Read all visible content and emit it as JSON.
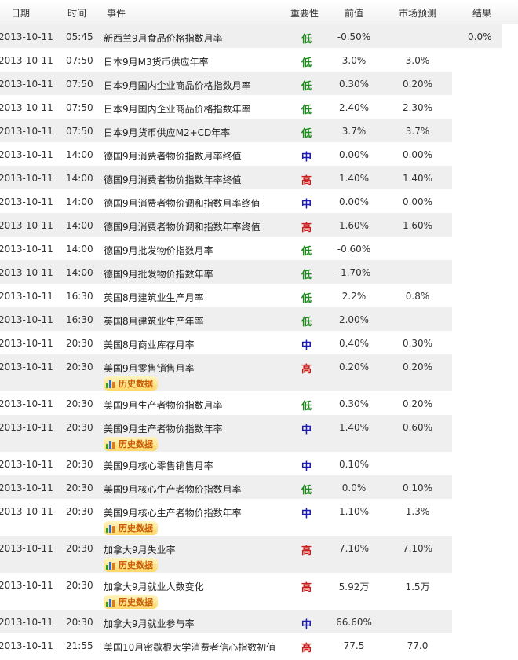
{
  "header": {
    "date": "日期",
    "time": "时间",
    "event": "事件",
    "importance": "重要性",
    "previous": "前值",
    "forecast": "市场预测",
    "actual": "结果"
  },
  "history_label": "历史数据",
  "importance_colors": {
    "低": "#1a8c1a",
    "中": "#1a1ab4",
    "高": "#cc1a1a"
  },
  "rows": [
    {
      "date": "2013-10-11",
      "time": "05:45",
      "event": "新西兰9月食品价格指数月率",
      "importance": "低",
      "previous": "-0.50%",
      "forecast": "",
      "actual": "0.0%",
      "history": false
    },
    {
      "date": "2013-10-11",
      "time": "07:50",
      "event": "日本9月M3货币供应年率",
      "importance": "低",
      "previous": "3.0%",
      "forecast": "3.0%",
      "actual": "",
      "history": false
    },
    {
      "date": "2013-10-11",
      "time": "07:50",
      "event": "日本9月国内企业商品价格指数月率",
      "importance": "低",
      "previous": "0.30%",
      "forecast": "0.20%",
      "actual": "",
      "history": false
    },
    {
      "date": "2013-10-11",
      "time": "07:50",
      "event": "日本9月国内企业商品价格指数年率",
      "importance": "低",
      "previous": "2.40%",
      "forecast": "2.30%",
      "actual": "",
      "history": false
    },
    {
      "date": "2013-10-11",
      "time": "07:50",
      "event": "日本9月货币供应M2+CD年率",
      "importance": "低",
      "previous": "3.7%",
      "forecast": "3.7%",
      "actual": "",
      "history": false
    },
    {
      "date": "2013-10-11",
      "time": "14:00",
      "event": "德国9月消费者物价指数月率终值",
      "importance": "中",
      "previous": "0.00%",
      "forecast": "0.00%",
      "actual": "",
      "history": false
    },
    {
      "date": "2013-10-11",
      "time": "14:00",
      "event": "德国9月消费者物价指数年率终值",
      "importance": "高",
      "previous": "1.40%",
      "forecast": "1.40%",
      "actual": "",
      "history": false
    },
    {
      "date": "2013-10-11",
      "time": "14:00",
      "event": "德国9月消费者物价调和指数月率终值",
      "importance": "中",
      "previous": "0.00%",
      "forecast": "0.00%",
      "actual": "",
      "history": false
    },
    {
      "date": "2013-10-11",
      "time": "14:00",
      "event": "德国9月消费者物价调和指数年率终值",
      "importance": "高",
      "previous": "1.60%",
      "forecast": "1.60%",
      "actual": "",
      "history": false
    },
    {
      "date": "2013-10-11",
      "time": "14:00",
      "event": "德国9月批发物价指数月率",
      "importance": "低",
      "previous": "-0.60%",
      "forecast": "",
      "actual": "",
      "history": false
    },
    {
      "date": "2013-10-11",
      "time": "14:00",
      "event": "德国9月批发物价指数年率",
      "importance": "低",
      "previous": "-1.70%",
      "forecast": "",
      "actual": "",
      "history": false
    },
    {
      "date": "2013-10-11",
      "time": "16:30",
      "event": "英国8月建筑业生产月率",
      "importance": "低",
      "previous": "2.2%",
      "forecast": "0.8%",
      "actual": "",
      "history": false
    },
    {
      "date": "2013-10-11",
      "time": "16:30",
      "event": "英国8月建筑业生产年率",
      "importance": "低",
      "previous": "2.00%",
      "forecast": "",
      "actual": "",
      "history": false
    },
    {
      "date": "2013-10-11",
      "time": "20:30",
      "event": "美国8月商业库存月率",
      "importance": "中",
      "previous": "0.40%",
      "forecast": "0.30%",
      "actual": "",
      "history": false
    },
    {
      "date": "2013-10-11",
      "time": "20:30",
      "event": "美国9月零售销售月率",
      "importance": "高",
      "previous": "0.20%",
      "forecast": "0.20%",
      "actual": "",
      "history": true
    },
    {
      "date": "2013-10-11",
      "time": "20:30",
      "event": "美国9月生产者物价指数月率",
      "importance": "低",
      "previous": "0.30%",
      "forecast": "0.20%",
      "actual": "",
      "history": false
    },
    {
      "date": "2013-10-11",
      "time": "20:30",
      "event": "美国9月生产者物价指数年率",
      "importance": "中",
      "previous": "1.40%",
      "forecast": "0.60%",
      "actual": "",
      "history": true
    },
    {
      "date": "2013-10-11",
      "time": "20:30",
      "event": "美国9月核心零售销售月率",
      "importance": "中",
      "previous": "0.10%",
      "forecast": "",
      "actual": "",
      "history": false
    },
    {
      "date": "2013-10-11",
      "time": "20:30",
      "event": "美国9月核心生产者物价指数月率",
      "importance": "低",
      "previous": "0.0%",
      "forecast": "0.10%",
      "actual": "",
      "history": false
    },
    {
      "date": "2013-10-11",
      "time": "20:30",
      "event": "美国9月核心生产者物价指数年率",
      "importance": "中",
      "previous": "1.10%",
      "forecast": "1.3%",
      "actual": "",
      "history": true
    },
    {
      "date": "2013-10-11",
      "time": "20:30",
      "event": "加拿大9月失业率",
      "importance": "高",
      "previous": "7.10%",
      "forecast": "7.10%",
      "actual": "",
      "history": true
    },
    {
      "date": "2013-10-11",
      "time": "20:30",
      "event": "加拿大9月就业人数变化",
      "importance": "高",
      "previous": "5.92万",
      "forecast": "1.5万",
      "actual": "",
      "history": true
    },
    {
      "date": "2013-10-11",
      "time": "20:30",
      "event": "加拿大9月就业参与率",
      "importance": "中",
      "previous": "66.60%",
      "forecast": "",
      "actual": "",
      "history": false
    },
    {
      "date": "2013-10-11",
      "time": "21:55",
      "event": "美国10月密歇根大学消费者信心指数初值",
      "importance": "高",
      "previous": "77.5",
      "forecast": "77.0",
      "actual": "",
      "history": false
    }
  ]
}
